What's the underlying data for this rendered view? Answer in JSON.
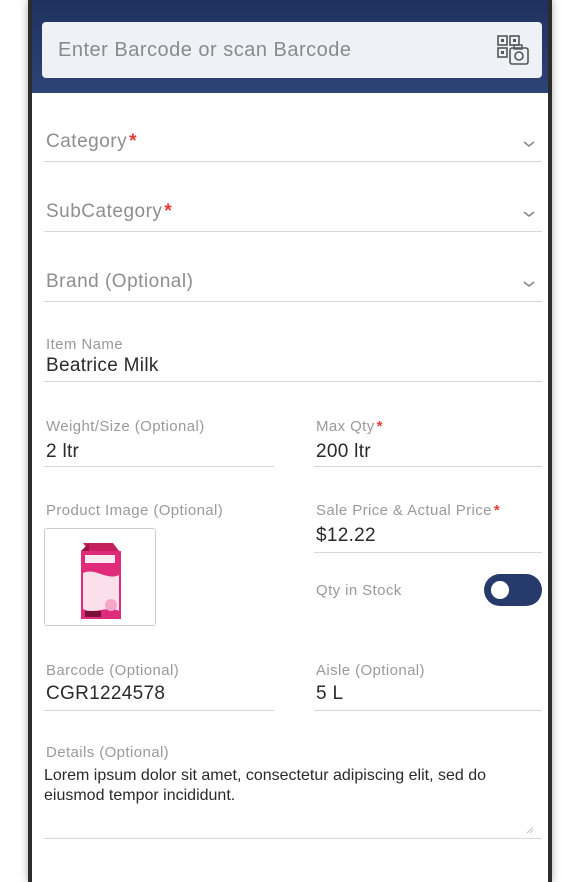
{
  "search": {
    "placeholder": "Enter Barcode or scan Barcode",
    "scan_icon": "barcode-camera-icon"
  },
  "form": {
    "category": {
      "label": "Category",
      "required": "*"
    },
    "subcategory": {
      "label": "SubCategory",
      "required": "*"
    },
    "brand": {
      "label": "Brand (Optional)"
    },
    "item_name": {
      "label": "Item Name",
      "value": "Beatrice Milk"
    },
    "weight": {
      "label": "Weight/Size (Optional)",
      "value": "2 ltr"
    },
    "max_qty": {
      "label": "Max Qty",
      "required": "*",
      "value": "200 ltr"
    },
    "product_image": {
      "label": "Product Image (Optional)"
    },
    "sale_price": {
      "label": "Sale Price & Actual Price",
      "required": "*",
      "value": "$12.22"
    },
    "qty_in_stock": {
      "label": "Qty in Stock",
      "enabled": true
    },
    "barcode": {
      "label": "Barcode (Optional)",
      "value": "CGR1224578"
    },
    "aisle": {
      "label": "Aisle (Optional)",
      "value": "5 L"
    },
    "details": {
      "label": "Details (Optional)",
      "value": "Lorem ipsum dolor sit amet, consectetur adipiscing elit, sed do eiusmod tempor incididunt."
    }
  },
  "colors": {
    "header": "#263a6b",
    "required": "#e53935",
    "toggle": "#263a6b"
  }
}
